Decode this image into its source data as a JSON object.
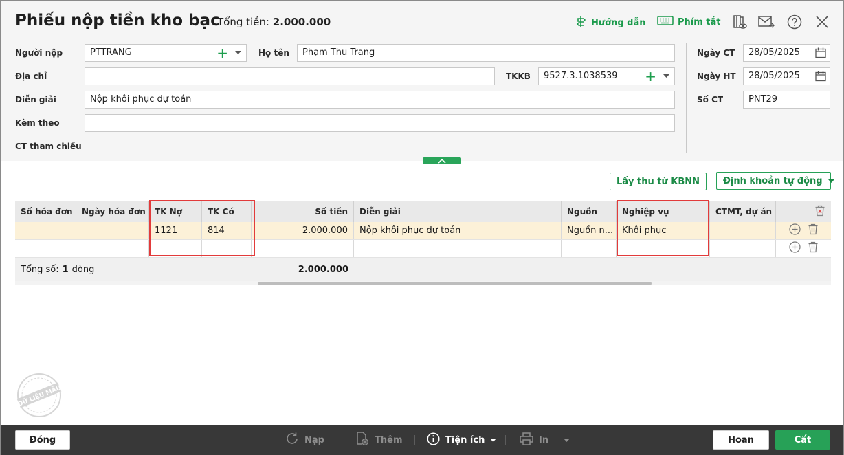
{
  "header": {
    "title": "Phiếu nộp tiền kho bạc",
    "total_label": "Tổng tiền:",
    "total_value": "2.000.000",
    "help_label": "Hướng dẫn",
    "shortcut_label": "Phím tắt"
  },
  "form": {
    "payer_label": "Người nộp",
    "payer_value": "PTTRANG",
    "fullname_label": "Họ tên",
    "fullname_value": "Phạm Thu Trang",
    "address_label": "Địa chỉ",
    "address_value": "",
    "tkkb_label": "TKKB",
    "tkkb_value": "9527.3.1038539",
    "desc_label": "Diễn giải",
    "desc_value": "Nộp khôi phục dự toán",
    "attach_label": "Kèm theo",
    "attach_value": "",
    "ref_label": "CT tham chiếu",
    "doc_date_label": "Ngày CT",
    "doc_date_value": "28/05/2025",
    "post_date_label": "Ngày HT",
    "post_date_value": "28/05/2025",
    "doc_no_label": "Số CT",
    "doc_no_value": "PNT29"
  },
  "actions": {
    "fetch_label": "Lấy thu từ KBNN",
    "auto_label": "Định khoản tự động"
  },
  "grid": {
    "columns": [
      "Số hóa đơn",
      "Ngày hóa đơn",
      "TK Nợ",
      "TK Có",
      "Số tiền",
      "Diễn giải",
      "Nguồn",
      "Nghiệp vụ",
      "CTMT, dự án"
    ],
    "rows": [
      {
        "invoice_no": "",
        "invoice_date": "",
        "debit": "1121",
        "credit": "814",
        "amount": "2.000.000",
        "desc": "Nộp khôi phục dự toán",
        "source": "Nguồn n...",
        "operation": "Khôi phục",
        "project": ""
      }
    ],
    "footer_prefix": "Tổng số:",
    "footer_count": "1",
    "footer_suffix": "dòng",
    "footer_total": "2.000.000"
  },
  "watermark_text": "DỮ LIỆU MẪU",
  "footer": {
    "close_label": "Đóng",
    "reload_label": "Nạp",
    "add_label": "Thêm",
    "utility_label": "Tiện ích",
    "print_label": "In",
    "cancel_label": "Hoãn",
    "save_label": "Cất"
  },
  "colors": {
    "accent": "#27a157",
    "highlight_row": "#fcf1d8",
    "annotation": "#e23b3b",
    "footer_bg": "#383838"
  }
}
